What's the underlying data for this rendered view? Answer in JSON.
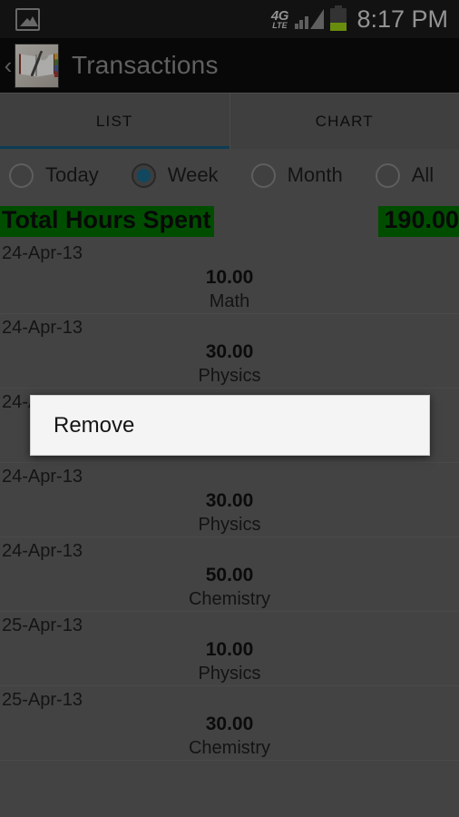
{
  "statusbar": {
    "notification_icon": "gallery-icon",
    "network": "4G",
    "network_sub": "LTE",
    "clock": "8:17 PM"
  },
  "actionbar": {
    "back_caret": "‹",
    "app_icon": "book-quill-icon",
    "title": "Transactions"
  },
  "tabs": [
    {
      "label": "LIST",
      "selected": true
    },
    {
      "label": "CHART",
      "selected": false
    }
  ],
  "filters": [
    {
      "label": "Today",
      "selected": false
    },
    {
      "label": "Week",
      "selected": true
    },
    {
      "label": "Month",
      "selected": false
    },
    {
      "label": "All",
      "selected": false
    }
  ],
  "total": {
    "label": "Total Hours Spent",
    "value": "190.00",
    "highlight_color": "#017201"
  },
  "transactions": [
    {
      "date": "24-Apr-13",
      "amount": "10.00",
      "category": "Math"
    },
    {
      "date": "24-Apr-13",
      "amount": "30.00",
      "category": "Physics"
    },
    {
      "date": "24-Apr-13",
      "amount": "",
      "category": ""
    },
    {
      "date": "24-Apr-13",
      "amount": "30.00",
      "category": "Physics"
    },
    {
      "date": "24-Apr-13",
      "amount": "50.00",
      "category": "Chemistry"
    },
    {
      "date": "25-Apr-13",
      "amount": "10.00",
      "category": "Physics"
    },
    {
      "date": "25-Apr-13",
      "amount": "30.00",
      "category": "Chemistry"
    }
  ],
  "dialog": {
    "items": [
      {
        "label": "Remove"
      }
    ]
  },
  "colors": {
    "accent_tab": "#13597c",
    "radio_selected": "#1b6a8c",
    "total_green": "#017201",
    "page_bg": "#636363"
  }
}
